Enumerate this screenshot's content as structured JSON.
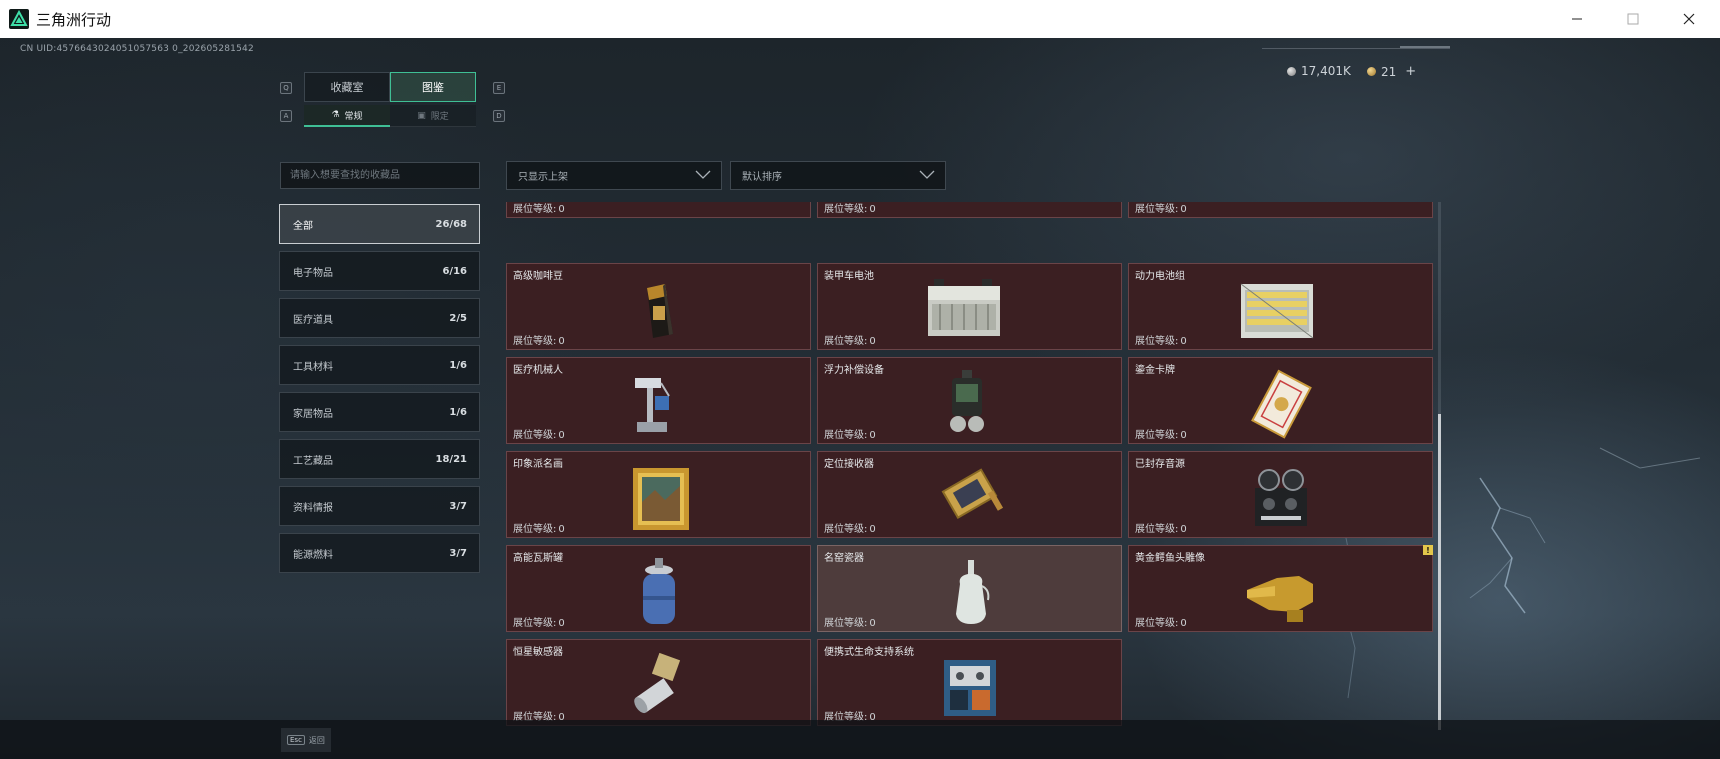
{
  "window": {
    "title": "三角洲行动",
    "controls": {
      "minimize": "—",
      "maximize": "☐",
      "close": "✕"
    }
  },
  "hud": {
    "uid": "CN UID:4576643024051057563 0_202605281542",
    "currency": [
      {
        "icon": "silver-coin-icon",
        "value": "17,401K"
      },
      {
        "icon": "gold-coin-icon",
        "value": "21"
      }
    ],
    "currency_add": "+"
  },
  "tabs": {
    "hint_left": "Q",
    "hint_right": "E",
    "items": [
      {
        "label": "收藏室",
        "active": false
      },
      {
        "label": "图鉴",
        "active": true
      }
    ]
  },
  "subtabs": {
    "hint_left": "A",
    "hint_right": "D",
    "items": [
      {
        "label": "常规",
        "icon": "flask-icon",
        "active": true
      },
      {
        "label": "限定",
        "icon": "crate-icon",
        "active": false
      }
    ]
  },
  "search": {
    "placeholder": "请输入想要查找的收藏品"
  },
  "filters": {
    "shelf": "只显示上架",
    "sort": "默认排序"
  },
  "categories": [
    {
      "label": "全部",
      "count": "26/68",
      "active": true
    },
    {
      "label": "电子物品",
      "count": "6/16",
      "active": false
    },
    {
      "label": "医疗道具",
      "count": "2/5",
      "active": false
    },
    {
      "label": "工具材料",
      "count": "1/6",
      "active": false
    },
    {
      "label": "家居物品",
      "count": "1/6",
      "active": false
    },
    {
      "label": "工艺藏品",
      "count": "18/21",
      "active": false
    },
    {
      "label": "资料情报",
      "count": "3/7",
      "active": false
    },
    {
      "label": "能源燃料",
      "count": "3/7",
      "active": false
    }
  ],
  "grid": {
    "level_label": "展位等级:",
    "partial_row": [
      {
        "level": "0"
      },
      {
        "level": "0"
      },
      {
        "level": "0"
      }
    ],
    "items": [
      {
        "name": "高级咖啡豆",
        "level": "0",
        "icon": "coffee-bag-icon"
      },
      {
        "name": "装甲车电池",
        "level": "0",
        "icon": "car-battery-icon"
      },
      {
        "name": "动力电池组",
        "level": "0",
        "icon": "battery-pack-icon"
      },
      {
        "name": "医疗机械人",
        "level": "0",
        "icon": "medical-robot-icon"
      },
      {
        "name": "浮力补偿设备",
        "level": "0",
        "icon": "buoyancy-device-icon"
      },
      {
        "name": "鎏金卡牌",
        "level": "0",
        "icon": "gilded-card-icon"
      },
      {
        "name": "印象派名画",
        "level": "0",
        "icon": "framed-painting-icon"
      },
      {
        "name": "定位接收器",
        "level": "0",
        "icon": "gps-receiver-icon"
      },
      {
        "name": "已封存音源",
        "level": "0",
        "icon": "reel-recorder-icon"
      },
      {
        "name": "高能瓦斯罐",
        "level": "0",
        "icon": "gas-canister-icon"
      },
      {
        "name": "名窑瓷器",
        "level": "0",
        "icon": "porcelain-vase-icon",
        "highlight": true
      },
      {
        "name": "黄金鳄鱼头雕像",
        "level": "0",
        "icon": "gold-crocodile-icon",
        "badge": "!"
      },
      {
        "name": "恒星敏感器",
        "level": "0",
        "icon": "star-sensor-icon"
      },
      {
        "name": "便携式生命支持系统",
        "level": "0",
        "icon": "life-support-icon"
      }
    ]
  },
  "footer": {
    "key": "Esc",
    "label": "返回"
  },
  "colors": {
    "accent": "#3fbf95",
    "card_bg": "#3b1f22",
    "card_border": "#6a4448",
    "card_highlight_bg": "#4e3c3c",
    "badge": "#e3c64b"
  }
}
